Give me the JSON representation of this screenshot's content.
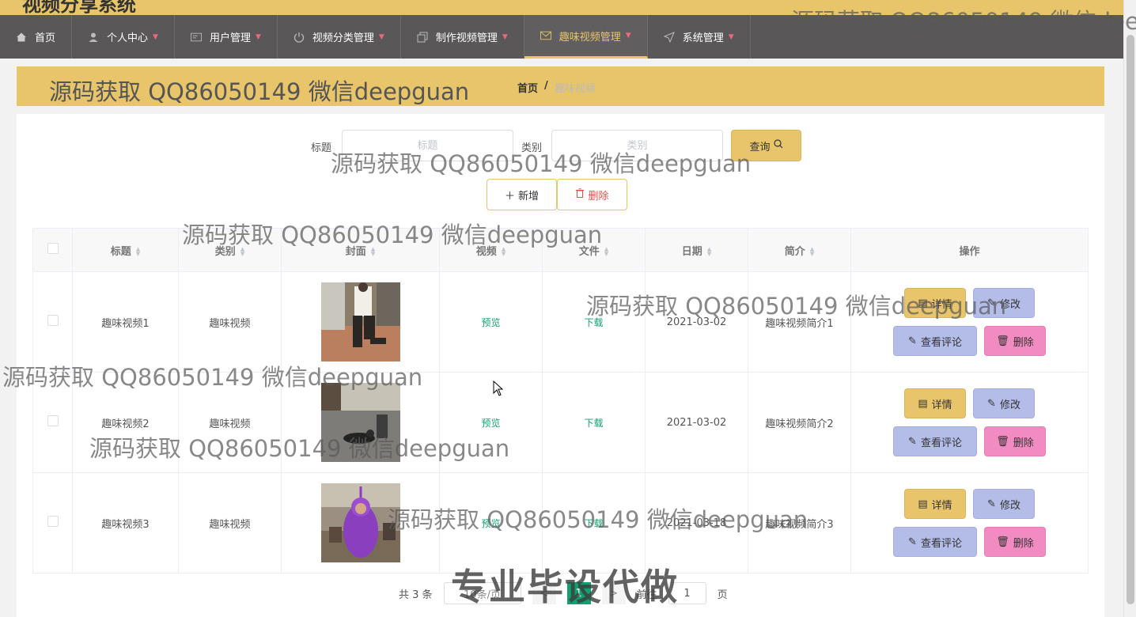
{
  "topbar": {
    "brand": "视频分享系统"
  },
  "nav": [
    {
      "label": "首页",
      "icon": "home-icon",
      "caret": false,
      "active": false
    },
    {
      "label": "个人中心",
      "icon": "user-icon",
      "caret": true,
      "active": false
    },
    {
      "label": "用户管理",
      "icon": "id-card-icon",
      "caret": true,
      "active": false
    },
    {
      "label": "视频分类管理",
      "icon": "power-icon",
      "caret": true,
      "active": false
    },
    {
      "label": "制作视频管理",
      "icon": "copy-icon",
      "caret": true,
      "active": false
    },
    {
      "label": "趣味视频管理",
      "icon": "mail-icon",
      "caret": true,
      "active": true
    },
    {
      "label": "系统管理",
      "icon": "send-icon",
      "caret": true,
      "active": false
    }
  ],
  "banner": {
    "title": "源码获取 QQ86050149 微信deepguan"
  },
  "breadcrumb": {
    "home": "首页",
    "sep": "/",
    "current": "趣味视频"
  },
  "search": {
    "title_label": "标题",
    "title_placeholder": "标题",
    "type_label": "类别",
    "type_placeholder": "类别",
    "query_button": "查询"
  },
  "actions": {
    "add": "新增",
    "delete": "删除"
  },
  "table": {
    "headers": [
      "标题",
      "类别",
      "封面",
      "视频",
      "文件",
      "日期",
      "简介",
      "操作"
    ],
    "rows": [
      {
        "title": "趣味视频1",
        "type": "趣味视频",
        "video": "预览",
        "file": "下载",
        "date": "2021-03-02",
        "intro": "趣味视频简介1"
      },
      {
        "title": "趣味视频2",
        "type": "趣味视频",
        "video": "预览",
        "file": "下载",
        "date": "2021-03-02",
        "intro": "趣味视频简介2"
      },
      {
        "title": "趣味视频3",
        "type": "趣味视频",
        "video": "预览",
        "file": "下载",
        "date": "2021-03-18",
        "intro": "趣味视频简介3"
      }
    ],
    "ops": {
      "detail": "详情",
      "edit": "修改",
      "comment": "查看评论",
      "delete": "删除"
    }
  },
  "pager": {
    "total": "共 3 条",
    "size": "10条/页",
    "prev": "<",
    "page": "1",
    "next": ">",
    "goto": "前往",
    "goto_value": "1",
    "page_unit": "页"
  },
  "watermarks": {
    "text": "源码获取 QQ86050149 微信deepguan",
    "big": "专业毕设代做"
  },
  "colors": {
    "accent": "#e8c46b",
    "nav_bg": "#595757",
    "link": "#13a06f",
    "delete_btn": "#f18bc2",
    "edit_btn": "#b3bde8"
  }
}
